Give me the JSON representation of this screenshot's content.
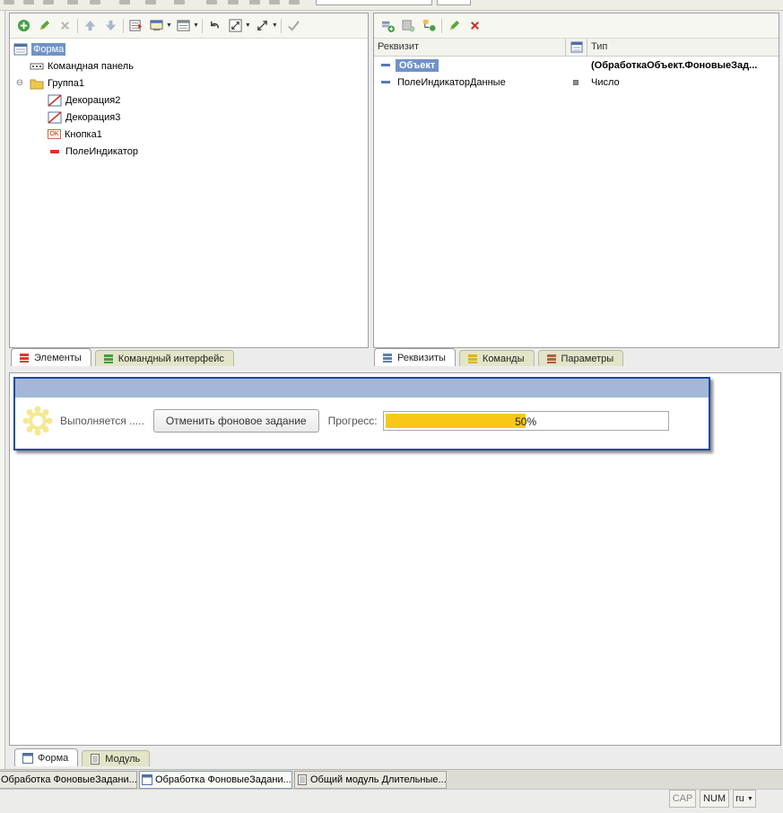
{
  "elements_tree": [
    {
      "label": "Форма",
      "icon": "form-icon",
      "selected": true
    },
    {
      "label": "Командная панель",
      "icon": "command-panel-icon"
    },
    {
      "label": "Группа1",
      "icon": "folder-icon",
      "collapsible": true
    },
    {
      "label": "Декорация2",
      "icon": "decoration-icon"
    },
    {
      "label": "Декорация3",
      "icon": "decoration-icon"
    },
    {
      "label": "Кнопка1",
      "icon": "button-ok-icon",
      "icon_text": "OK"
    },
    {
      "label": "ПолеИндикатор",
      "icon": "field-icon"
    }
  ],
  "left_tabs": [
    {
      "label": "Элементы",
      "active": true
    },
    {
      "label": "Командный интерфейс"
    }
  ],
  "attributes": {
    "columns": [
      "Реквизит",
      "Тип"
    ],
    "rows": [
      {
        "name": "Объект",
        "type": "(ОбработкаОбъект.ФоновыеЗад...",
        "selected": true
      },
      {
        "name": "ПолеИндикаторДанные",
        "type": "Число"
      }
    ]
  },
  "right_tabs": [
    {
      "label": "Реквизиты",
      "active": true
    },
    {
      "label": "Команды"
    },
    {
      "label": "Параметры"
    }
  ],
  "dialog": {
    "status_text": "Выполняется .....",
    "cancel_button": "Отменить фоновое задание",
    "progress_label": "Прогресс:",
    "progress_value": 50,
    "progress_text": "50%"
  },
  "bottom_tabs": [
    {
      "label": "Форма",
      "active": true
    },
    {
      "label": "Модуль"
    }
  ],
  "taskbar": [
    {
      "label": "Обработка ФоновыеЗадани..."
    },
    {
      "label": "Обработка ФоновыеЗадани...",
      "active": true
    },
    {
      "label": "Общий модуль Длительные..."
    }
  ],
  "status": {
    "cap": "CAP",
    "num": "NUM",
    "lang": "ru"
  },
  "colors": {
    "selection": "#7092c8",
    "progress_fill": "#f8c818",
    "dialog_title": "#a3b8d8",
    "dialog_border": "#1a48a8"
  }
}
